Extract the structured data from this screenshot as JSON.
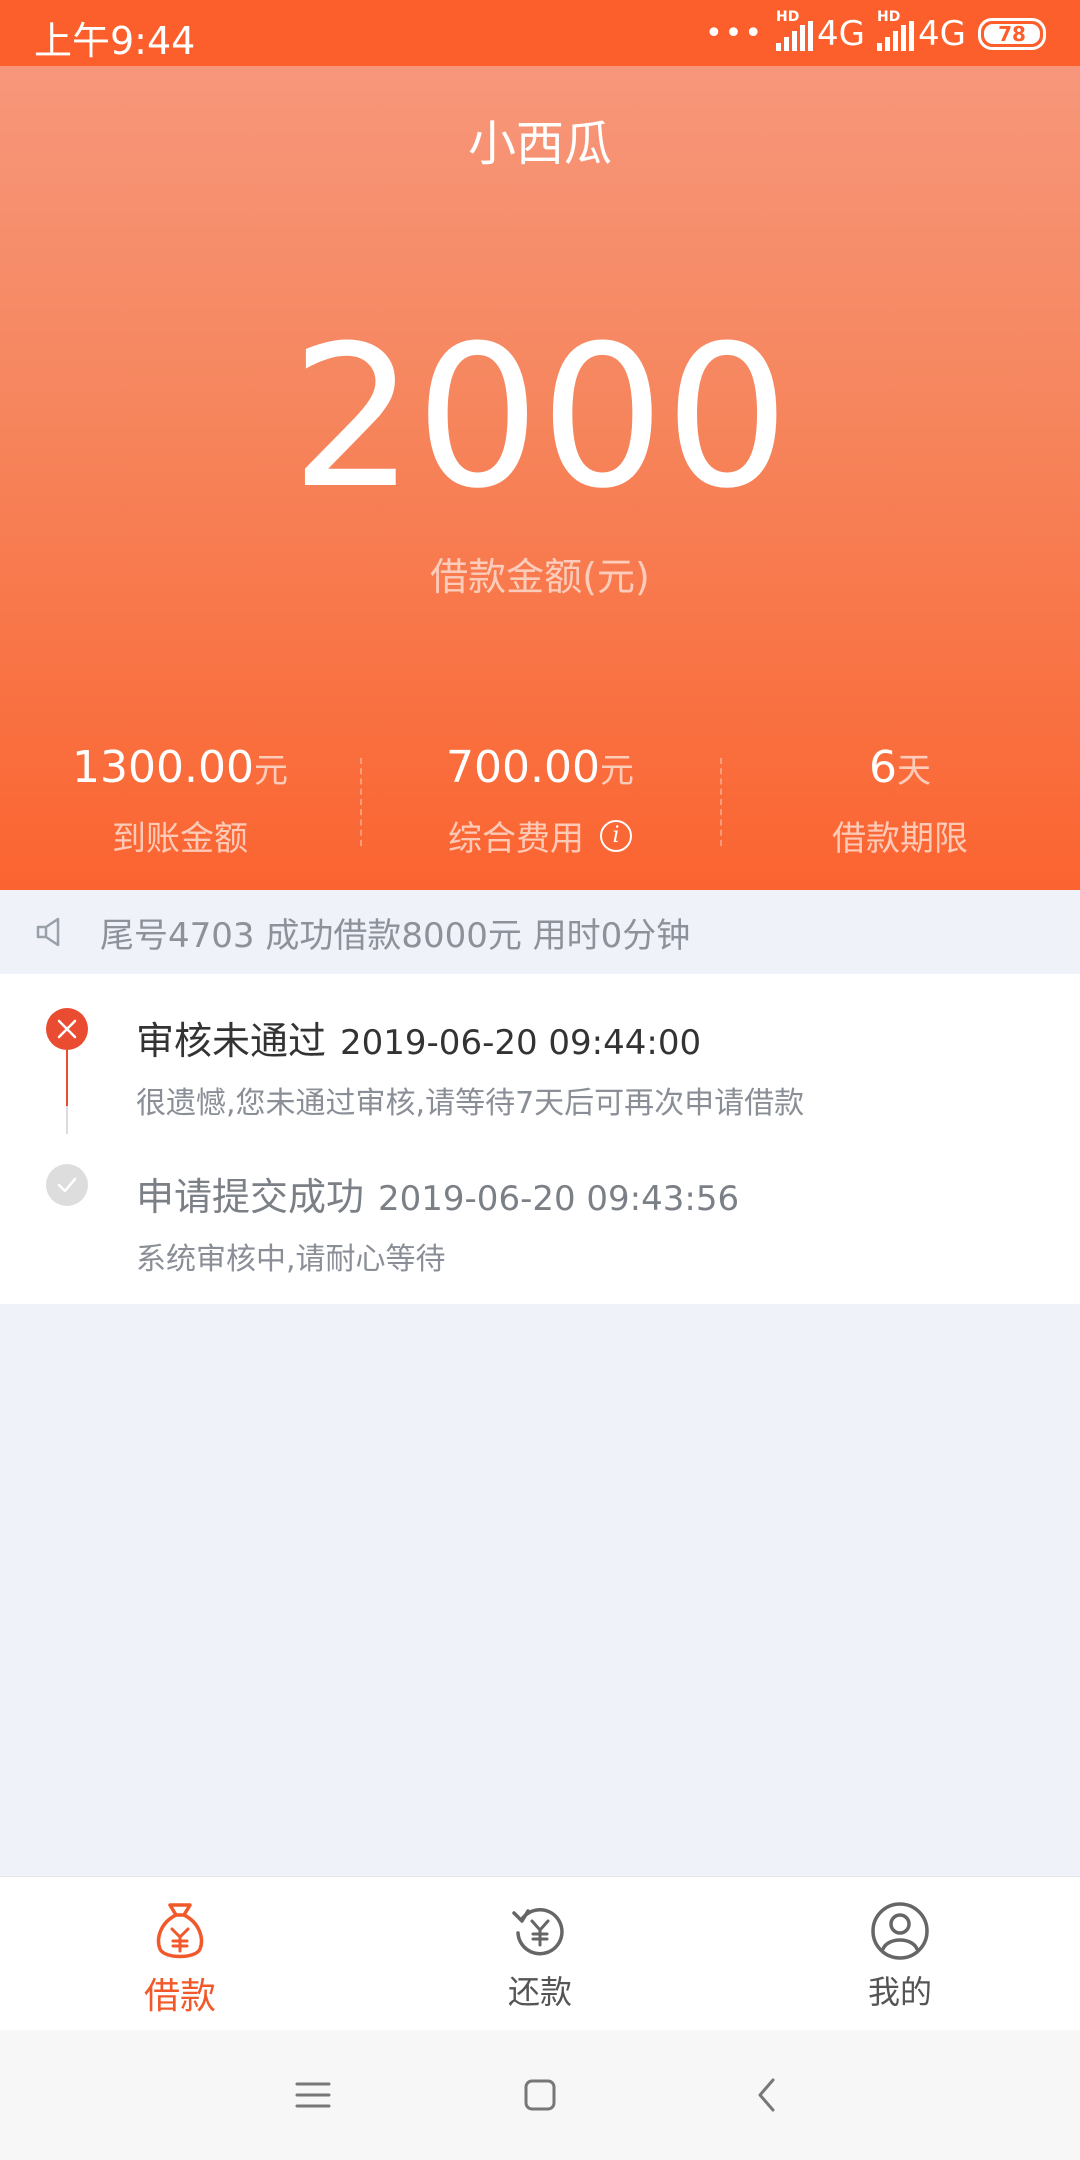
{
  "status_bar": {
    "time": "上午9:44",
    "dots": "•••",
    "hd": "HD",
    "network1": "4G",
    "network2": "4G",
    "battery": "78"
  },
  "header": {
    "title": "小西瓜"
  },
  "loan": {
    "amount": "2000",
    "amount_label": "借款金额(元)"
  },
  "stats": [
    {
      "value": "1300.00",
      "unit": "元",
      "label": "到账金额"
    },
    {
      "value": "700.00",
      "unit": "元",
      "label": "综合费用"
    },
    {
      "value": "6",
      "unit": "天",
      "label": "借款期限"
    }
  ],
  "notice": {
    "text": "尾号4703 成功借款8000元 用时0分钟"
  },
  "timeline": [
    {
      "title": "审核未通过",
      "time": "2019-06-20 09:44:00",
      "desc": "很遗憾,您未通过审核,请等待7天后可再次申请借款",
      "status": "rejected"
    },
    {
      "title": "申请提交成功",
      "time": "2019-06-20 09:43:56",
      "desc": "系统审核中,请耐心等待",
      "status": "done"
    }
  ],
  "tabs": [
    {
      "label": "借款",
      "icon": "money-bag-icon",
      "active": true
    },
    {
      "label": "还款",
      "icon": "repay-icon",
      "active": false
    },
    {
      "label": "我的",
      "icon": "user-icon",
      "active": false
    }
  ],
  "colors": {
    "accent": "#f2592a",
    "status_bar": "#fc5f2c",
    "reject": "#ea4c32",
    "done": "#dddddd"
  }
}
